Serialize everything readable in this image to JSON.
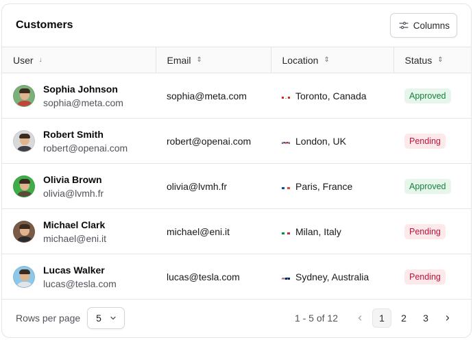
{
  "header": {
    "title": "Customers",
    "columns_button": "Columns"
  },
  "table": {
    "columns": [
      {
        "label": "User",
        "sort": "↓"
      },
      {
        "label": "Email",
        "sort": "⇕"
      },
      {
        "label": "Location",
        "sort": "⇕"
      },
      {
        "label": "Status",
        "sort": "⇕"
      }
    ],
    "rows": [
      {
        "name": "Sophia Johnson",
        "user_email": "sophia@meta.com",
        "email": "sophia@meta.com",
        "location": "Toronto, Canada",
        "flag": "canada-flag",
        "status": "Approved",
        "avatar_bg": "#7bb07a",
        "shirt": "#c2453d"
      },
      {
        "name": "Robert Smith",
        "user_email": "robert@openai.com",
        "email": "robert@openai.com",
        "location": "London, UK",
        "flag": "uk-flag",
        "status": "Pending",
        "avatar_bg": "#d9d9d9",
        "shirt": "#3f3f46"
      },
      {
        "name": "Olivia Brown",
        "user_email": "olivia@lvmh.fr",
        "email": "olivia@lvmh.fr",
        "location": "Paris, France",
        "flag": "france-flag",
        "status": "Approved",
        "avatar_bg": "#3fae49",
        "shirt": "#5a4a3a"
      },
      {
        "name": "Michael Clark",
        "user_email": "michael@eni.it",
        "email": "michael@eni.it",
        "location": "Milan, Italy",
        "flag": "italy-flag",
        "status": "Pending",
        "avatar_bg": "#7a5b48",
        "shirt": "#2b2b2b"
      },
      {
        "name": "Lucas Walker",
        "user_email": "lucas@tesla.com",
        "email": "lucas@tesla.com",
        "location": "Sydney, Australia",
        "flag": "australia-flag",
        "status": "Pending",
        "avatar_bg": "#8fc7e8",
        "shirt": "#e4e4e7"
      }
    ]
  },
  "status_colors": {
    "Approved": {
      "bg": "#e7f6ea",
      "fg": "#15803d"
    },
    "Pending": {
      "bg": "#fde8ea",
      "fg": "#be123c"
    }
  },
  "footer": {
    "rows_per_page_label": "Rows per page",
    "rows_per_page_value": "5",
    "range": "1 - 5 of 12",
    "pages": [
      "1",
      "2",
      "3"
    ],
    "current_page": "1"
  }
}
